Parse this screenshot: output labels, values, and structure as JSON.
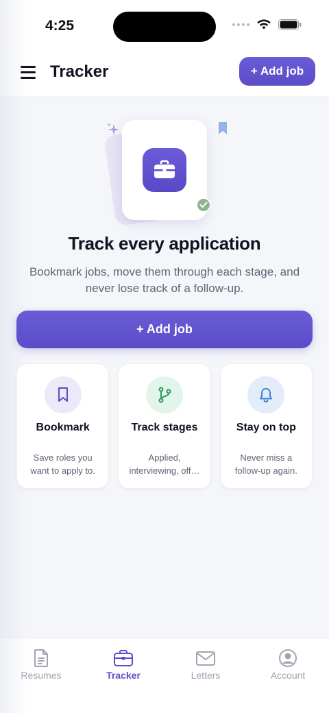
{
  "status_bar": {
    "time": "4:25"
  },
  "header": {
    "title": "Tracker",
    "add_button_label": "+ Add job"
  },
  "empty_state": {
    "title": "Track every application",
    "subtitle": "Bookmark jobs, move them through each stage, and never lose track of a follow-up.",
    "add_button_label": "+ Add job",
    "hero_icon": "briefcase-icon"
  },
  "features": [
    {
      "title": "Bookmark",
      "description": "Save roles you want to apply to.",
      "icon": "bookmark-icon",
      "icon_bg": "#ece9f8",
      "icon_color": "#5b4cc8"
    },
    {
      "title": "Track stages",
      "description": "Applied, interviewing, off…",
      "icon": "branch-icon",
      "icon_bg": "#e3f4ea",
      "icon_color": "#2e9b5e"
    },
    {
      "title": "Stay on top",
      "description": "Never miss a follow-up again.",
      "icon": "bell-icon",
      "icon_bg": "#e3ecf9",
      "icon_color": "#3b82d6"
    }
  ],
  "bottom_nav": {
    "items": [
      {
        "label": "Resumes",
        "icon": "document-icon",
        "active": false
      },
      {
        "label": "Tracker",
        "icon": "briefcase-icon",
        "active": true
      },
      {
        "label": "Letters",
        "icon": "envelope-icon",
        "active": false
      },
      {
        "label": "Account",
        "icon": "user-circle-icon",
        "active": false
      }
    ]
  },
  "colors": {
    "accent": "#5b4cc8",
    "background": "#f5f6fa",
    "text_primary": "#111322",
    "text_secondary": "#5f6475",
    "nav_inactive": "#a0a4b1",
    "check_badge": "#8fb38f"
  }
}
